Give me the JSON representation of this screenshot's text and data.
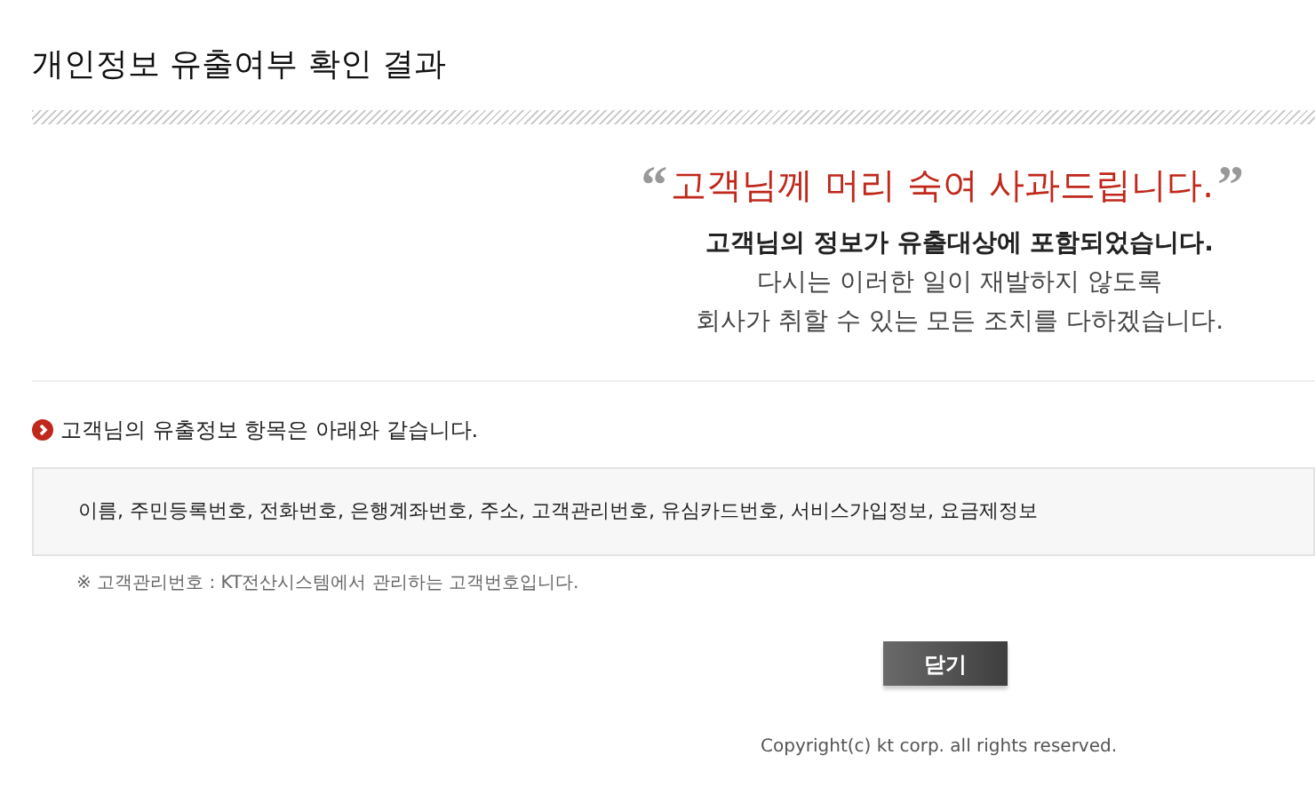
{
  "title": "개인정보 유출여부 확인 결과",
  "apology": {
    "open_quote": "“",
    "heading": "고객님께 머리 숙여 사과드립니다.",
    "close_quote": "”",
    "lines": [
      "고객님의 정보가 유출대상에 포함되었습니다.",
      "다시는 이러한 일이 재발하지 않도록",
      "회사가 취할 수 있는 모든 조치를 다하겠습니다."
    ]
  },
  "section_heading": "고객님의 유출정보 항목은 아래와 같습니다.",
  "leaked_items": "이름, 주민등록번호, 전화번호, 은행계좌번호, 주소, 고객관리번호, 유심카드번호, 서비스가입정보, 요금제정보",
  "note": "※ 고객관리번호 : KT전산시스템에서 관리하는 고객번호입니다.",
  "buttons": [
    "닫기"
  ],
  "footer": "Copyright(c) kt corp. all rights reserved."
}
